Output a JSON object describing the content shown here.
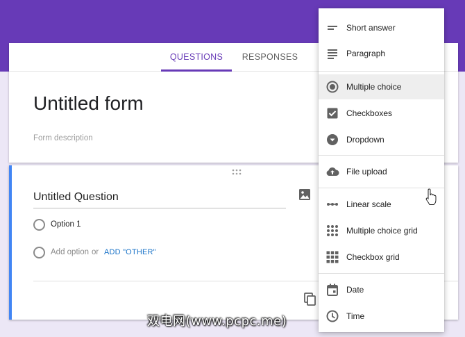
{
  "tabs": {
    "questions": "QUESTIONS",
    "responses": "RESPONSES"
  },
  "form": {
    "title": "Untitled form",
    "description_placeholder": "Form description"
  },
  "question": {
    "title": "Untitled Question",
    "option1": "Option 1",
    "add_option": "Add option",
    "or": "or",
    "add_other": "ADD \"OTHER\""
  },
  "menu": {
    "items": [
      {
        "label": "Short answer",
        "icon": "short-text-icon"
      },
      {
        "label": "Paragraph",
        "icon": "paragraph-icon"
      },
      {
        "label": "Multiple choice",
        "icon": "radio-button-icon",
        "selected": true
      },
      {
        "label": "Checkboxes",
        "icon": "checkbox-icon"
      },
      {
        "label": "Dropdown",
        "icon": "dropdown-icon"
      },
      {
        "label": "File upload",
        "icon": "cloud-upload-icon"
      },
      {
        "label": "Linear scale",
        "icon": "linear-scale-icon"
      },
      {
        "label": "Multiple choice grid",
        "icon": "mc-grid-icon"
      },
      {
        "label": "Checkbox grid",
        "icon": "checkbox-grid-icon"
      },
      {
        "label": "Date",
        "icon": "calendar-icon"
      },
      {
        "label": "Time",
        "icon": "clock-icon"
      }
    ]
  },
  "watermark": "双电网(www.pcpc.me)",
  "colors": {
    "accent": "#673ab7",
    "link": "#1a73c8",
    "question_border": "#4285f4",
    "background": "#ece7f6"
  }
}
